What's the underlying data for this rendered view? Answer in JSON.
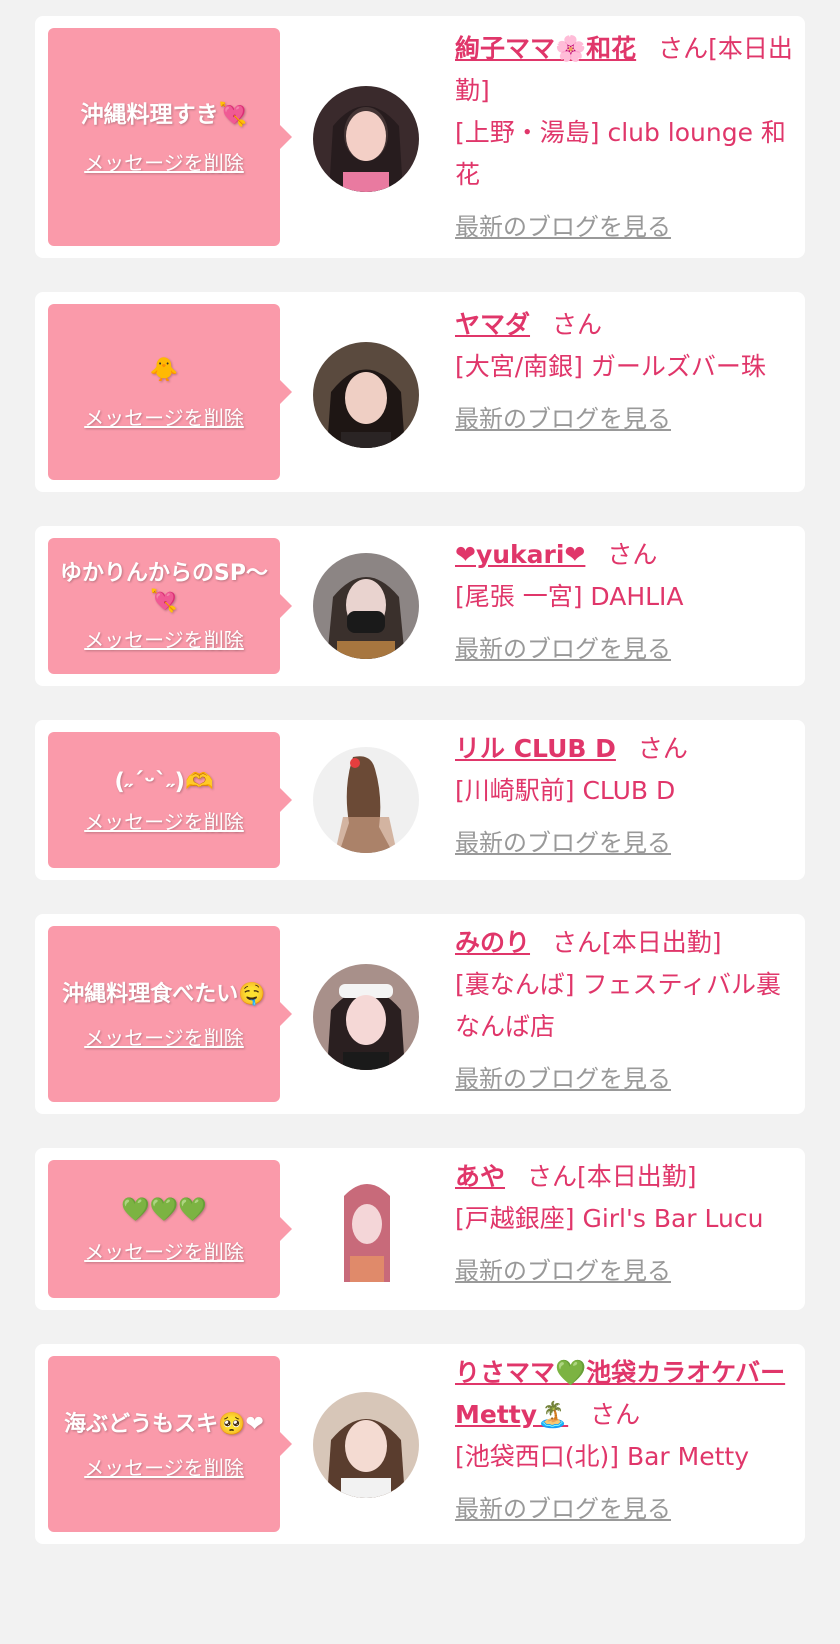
{
  "delete_label": "メッセージを削除",
  "blog_label": "最新のブログを見る",
  "san_label": "さん",
  "cards": [
    {
      "message": "沖縄料理すき💘",
      "name": "絢子ママ🌸和花",
      "status": "[本日出勤]",
      "shop": "[上野・湯島] club lounge 和花",
      "avatar": "portrait"
    },
    {
      "message": "🐥",
      "name": "ヤマダ",
      "status": "",
      "shop": "[大宮/南銀] ガールズバー珠",
      "avatar": "portrait"
    },
    {
      "message": "ゆかりんからのSP〜💘",
      "name": "❤yukari❤",
      "status": "",
      "shop": "[尾張 一宮] DAHLIA",
      "avatar": "portrait"
    },
    {
      "message": "(˶ˊᵕˋ˶)🫶",
      "name": "リル CLUB D",
      "status": "",
      "shop": "[川崎駅前] CLUB D",
      "avatar": "back-view"
    },
    {
      "message": "沖縄料理食べたい🤤",
      "name": "みのり",
      "status": "[本日出勤]",
      "shop": "[裏なんば] フェスティバル裏なんば店",
      "avatar": "portrait"
    },
    {
      "message": "💚💚💚",
      "name": "あや",
      "status": "[本日出勤]",
      "shop": "[戸越銀座] Girl's Bar Lucu",
      "avatar": "portrait"
    },
    {
      "message": "海ぶどうもスキ🥺❤",
      "name": "りさママ💚池袋カラオケバーMetty🏝️",
      "status": "",
      "shop": "[池袋西口(北)] Bar Metty",
      "avatar": "portrait"
    }
  ]
}
